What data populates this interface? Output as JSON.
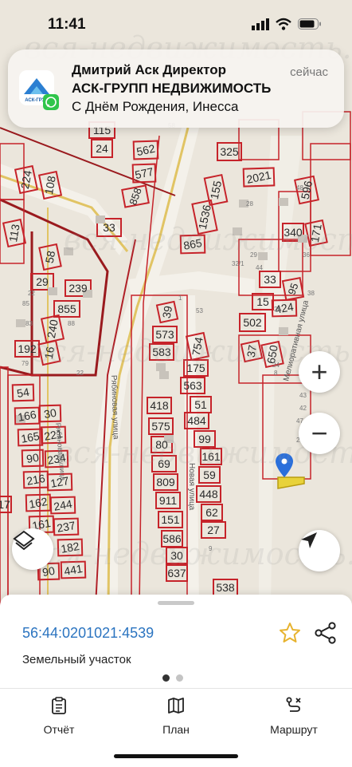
{
  "status_bar": {
    "time": "11:41"
  },
  "notification": {
    "sender": "Дмитрий Аск Директор",
    "company": "АСК-ГРУПП НЕДВИЖИМОСТЬ",
    "message": "С Днём Рождения, Инесса",
    "time": "сейчас",
    "logo_text": "АСК-ГРУП"
  },
  "map": {
    "streets": [
      "Рябиновая улица",
      "Мелиоративная улица",
      "Новая улица"
    ],
    "parcels": [
      "115",
      "24",
      "562",
      "577",
      "858",
      "325",
      "155",
      "2021",
      "596",
      "224",
      "108",
      "113",
      "33",
      "1536",
      "340",
      "171",
      "865",
      "58",
      "29",
      "239",
      "855",
      "33",
      "95",
      "15",
      "424",
      "240",
      "192",
      "16",
      "502",
      "37",
      "650",
      "39",
      "573",
      "583",
      "754",
      "175",
      "563",
      "418",
      "51",
      "575",
      "484",
      "80",
      "99",
      "69",
      "161",
      "809",
      "59",
      "911",
      "448",
      "151",
      "62",
      "586",
      "27",
      "30",
      "637",
      "538",
      "54",
      "166",
      "30",
      "165",
      "221",
      "90",
      "234",
      "216",
      "127",
      "162",
      "244",
      "161",
      "237",
      "182",
      "90",
      "441",
      "17",
      "22",
      "85",
      "83",
      "88",
      "79",
      "28",
      "32/1",
      "44",
      "36",
      "29",
      "38",
      "26",
      "24",
      "8",
      "1",
      "53",
      "39",
      "43",
      "42",
      "47",
      "25",
      "9",
      "58",
      "48"
    ],
    "zoom_in": "+",
    "zoom_out": "−",
    "layers_icon": "layers-icon",
    "locate_icon": "navigation-arrow-icon",
    "pin_color": "#2a6fdb"
  },
  "watermark": "вся-недвижимость.net",
  "sheet": {
    "cadastral_number": "56:44:0201021:4539",
    "type": "Земельный участок",
    "favorite_icon": "star-icon",
    "share_icon": "share-icon",
    "page_index": 1,
    "page_count": 2
  },
  "tabs": [
    {
      "label": "Отчёт",
      "icon": "report-icon"
    },
    {
      "label": "План",
      "icon": "map-icon"
    },
    {
      "label": "Маршрут",
      "icon": "route-icon"
    }
  ],
  "colors": {
    "parcel_line": "#c6232a",
    "link": "#2b74c0",
    "star": "#e7b32f"
  }
}
